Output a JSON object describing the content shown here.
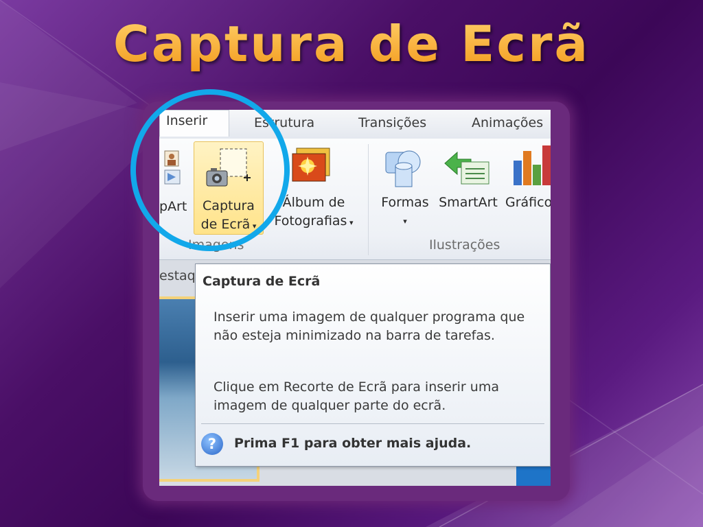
{
  "slide": {
    "title": "Captura de Ecrã"
  },
  "ribbon": {
    "tabs": [
      "Inserir",
      "Estrutura",
      "Transições",
      "Animações"
    ],
    "active_tab": "Inserir",
    "groups": {
      "imagens": {
        "label": "Imagens",
        "buttons": {
          "clipart_partial": "pArt",
          "captura_line1": "Captura",
          "captura_line2": "de Ecrã",
          "album_line1": "Álbum de",
          "album_line2": "Fotografias"
        }
      },
      "ilustracoes": {
        "label": "Ilustrações",
        "buttons": {
          "formas": "Formas",
          "smartart": "SmartArt",
          "grafico": "Gráfico"
        }
      }
    }
  },
  "content": {
    "destaque_partial": "estaq"
  },
  "tooltip": {
    "title": "Captura de Ecrã",
    "body1": "Inserir uma imagem de qualquer programa que não esteja minimizado na barra de tarefas.",
    "body2": "Clique em Recorte de Ecrã para inserir uma imagem de qualquer parte do ecrã.",
    "help": "Prima F1 para obter mais ajuda.",
    "help_icon_glyph": "?"
  },
  "colors": {
    "highlight_circle": "#12a8ea",
    "title_orange": "#f39a1c",
    "background_purple": "#4a0f66"
  }
}
